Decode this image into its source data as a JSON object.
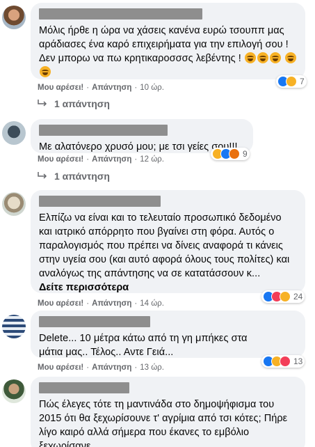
{
  "comments": [
    {
      "text": "Μόλις ήρθε η ώρα να χάσεις κανένα ευρώ τσουππ μας αράδιασες ένα καρό επιχειρήματα για την επιλογή σου ! Δεν μπορω να πω κρητικαροσσσς λεβέντης !",
      "like": "Μου αρέσει!",
      "reply": "Απάντηση",
      "time": "10 ώρ.",
      "reactions": [
        "like",
        "haha"
      ],
      "count": "7",
      "replies": "1 απάντηση"
    },
    {
      "text": "Με αλατόνερο χρυσό μου; με τσι γείες σου!!!",
      "like": "Μου αρέσει!",
      "reply": "Απάντηση",
      "time": "12 ώρ.",
      "reactions": [
        "haha",
        "like",
        "angry"
      ],
      "count": "9",
      "replies": "1 απάντηση"
    },
    {
      "text": "Ελπίζω να είναι και το τελευταίο προσωπικό δεδομένο και ιατρικό απόρρητο που βγαίνει στη φόρα. Αυτός ο παραλογισμός που πρέπει να δίνεις αναφορά τι κάνεις στην υγεία σου (και αυτό αφορά όλους τους πολίτες) και αναλόγως της απάντησης να σε κατατάσσουν κ...",
      "see_more": "Δείτε περισσότερα",
      "like": "Μου αρέσει!",
      "reply": "Απάντηση",
      "time": "14 ώρ.",
      "reactions": [
        "like",
        "love",
        "haha"
      ],
      "count": "24"
    },
    {
      "text": "Delete... 10 μέτρα κάτω από τη γη μπήκες στα μάτια μας.. Τέλος.. Αντε Γειά...",
      "like": "Μου αρέσει!",
      "reply": "Απάντηση",
      "time": "13 ώρ.",
      "reactions": [
        "like",
        "haha",
        "love"
      ],
      "count": "13"
    },
    {
      "text": "Πώς έλεγες τότε τη μαντινάδα στο δημοψήφισμα του 2015 ότι θα ξεχωρίσουνε τ' αγρίμια από τσι κότες; Πήρε λίγο καιρό αλλά σήμερα που έκανες το εμβόλιο ξεχωρίσανε..."
    }
  ],
  "colors": {
    "bubble": "#f0f2f5",
    "meta_text": "#65676b",
    "like_blue": "#1877f2",
    "haha_yellow": "#f7b125",
    "love_red": "#f33e58",
    "angry_orange": "#e9710f"
  }
}
